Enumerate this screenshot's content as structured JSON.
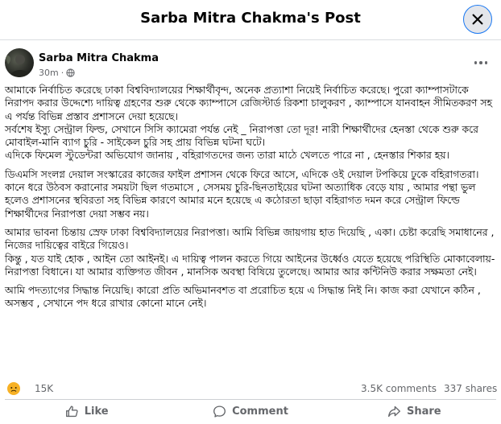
{
  "header": {
    "title": "Sarba Mitra Chakma's Post"
  },
  "post": {
    "author": "Sarba Mitra Chakma",
    "time": "30m",
    "separator": "·",
    "paragraphs": [
      "আমাকে নির্বাচিত করেছে ঢাকা বিশ্ববিদ্যালয়ের শিক্ষার্থীবৃন্দ, অনেক প্রত্যাশা নিয়েই নির্বাচিত করেছে। পুরো ক্যাম্পাসটাকে নিরাপদ করার উদ্দেশ্যে দায়িত্ব গ্রহণের শুরু থেকে ক্যাম্পাসে রেজিস্টার্ড রিকশা চালুকরণ , ক্যাম্পাসে যানবাহন সীমিতকরণ সহ এ পর্যন্ত বিভিন্ন প্রস্তাব প্রশাসনে দেয়া হয়েছে।\nসর্বশেষ ইস্যু সেন্ট্রাল ফিল্ড, সেখানে সিসি ক্যামেরা পর্যন্ত নেই _ নিরাপত্তা তো দূর! নারী শিক্ষার্থীদের হেনস্তা থেকে শুরু করে মোবাইল-মানি ব্যাগ চুরি - সাইকেল চুরি সহ প্রায় বিভিন্ন ঘটনা ঘটে।\nএদিকে ফিমেল স্টুডেন্টরা অভিযোগ জানায় , বহিরাগতদের জন্য তারা মাঠে খেলতে পারে না , হেনস্তার শিকার হয়।",
      "ডিএমসি সংলগ্ন দেয়াল সংস্কারের কাজের ফাইল প্রশাসন থেকে ফিরে আসে, এদিকে ওই দেয়াল টপকিয়ে ঢুকে বহিরাগতরা।\nকানে ধরে উঠবস করানোর সময়টা ছিল গতমাসে , সেসময় চুরি-ছিনতাইয়ের ঘটনা অত্যাধিক বেড়ে যায় , আমার পন্থা ভুল হলেও প্রশাসনের স্থবিরতা সহ বিভিন্ন কারণে আমার মনে হয়েছে এ কঠোরতা ছাড়া বহিরাগত দমন করে সেন্ট্রাল ফিল্ডে শিক্ষার্থীদের নিরাপত্তা দেয়া সম্ভব নয়।",
      "আমার ভাবনা চিন্তায় স্রেফ ঢাকা বিশ্ববিদ্যালয়ের নিরাপত্তা। আমি বিভিন্ন জায়গায় হাত দিয়েছি , একা। চেষ্টা করেছি সমাধানের , নিজের দায়িত্বের বাইরে গিয়েও।\nকিন্তু , যত যাই হোক , আইন তো আইনই। এ দায়িত্ব পালন করতে গিয়ে আইনের উর্ধ্বেও যেতে হয়েছে পরিস্থিতি মোকাবেলায়-নিরাপত্তা বিধানে। যা আমার ব্যক্তিগত জীবন , মানসিক অবস্থা বিষিয়ে তুলেছে। আমার আর কন্টিনিউ করার সক্ষমতা নেই।",
      "আমি পদত্যাগের সিদ্ধান্ত নিয়েছি। কারো প্রতি অভিমানবশত বা প্ররোচিত হয়ে এ সিদ্ধান্ত নিই নি। কাজ করা যেখানে কঠিন , অসম্ভব , সেখানে পদ ধরে রাখার কোনো মানে নেই।"
    ]
  },
  "stats": {
    "reactions": "15K",
    "comments": "3.5K comments",
    "shares": "337 shares"
  },
  "actions": {
    "like": "Like",
    "comment": "Comment",
    "share": "Share"
  },
  "colors": {
    "accent": "#1877f2",
    "muted": "#65676b",
    "reaction": "#f7b125"
  },
  "icons": {
    "close": "close-icon",
    "privacy": "globe-icon",
    "more": "more-icon",
    "reaction": "sad-reaction-icon",
    "like": "thumbs-up-icon",
    "comment": "comment-icon",
    "share": "share-icon"
  }
}
